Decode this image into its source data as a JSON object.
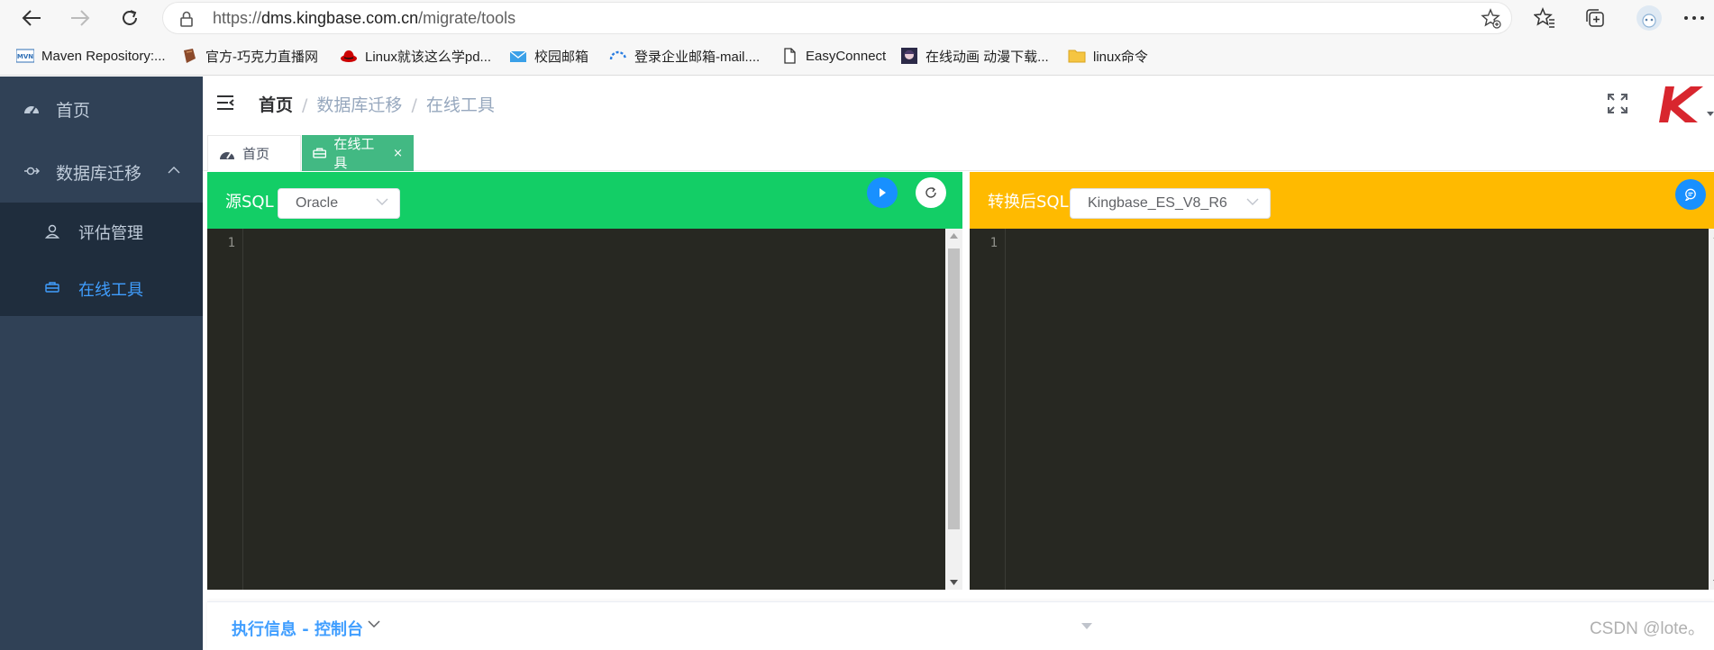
{
  "browser": {
    "url_prefix": "https://",
    "url_host": "dms.kingbase.com.cn",
    "url_path": "/migrate/tools"
  },
  "bookmarks": [
    {
      "label": "Maven Repository:...",
      "icon": "maven-icon"
    },
    {
      "label": "官方-巧克力直播网",
      "icon": "chocolate-icon"
    },
    {
      "label": "Linux就该这么学pd...",
      "icon": "redhat-icon"
    },
    {
      "label": "校园邮箱",
      "icon": "mail-icon"
    },
    {
      "label": "登录企业邮箱-mail....",
      "icon": "cloud-mail-icon"
    },
    {
      "label": "EasyConnect",
      "icon": "page-icon"
    },
    {
      "label": "在线动画 动漫下载...",
      "icon": "anime-icon"
    },
    {
      "label": "linux命令",
      "icon": "folder-icon"
    }
  ],
  "sidebar": {
    "home": "首页",
    "db_migrate": "数据库迁移",
    "items": [
      {
        "label": "评估管理"
      },
      {
        "label": "在线工具"
      }
    ]
  },
  "breadcrumb": {
    "home": "首页",
    "sep": "/",
    "level1": "数据库迁移",
    "level2": "在线工具"
  },
  "tags": {
    "home": "首页",
    "active": "在线工具",
    "close": "×"
  },
  "source": {
    "label": "源SQL",
    "db": "Oracle",
    "line": "1"
  },
  "target": {
    "label": "转换后SQL",
    "db": "Kingbase_ES_V8_R6",
    "line": "1"
  },
  "console": {
    "title": "执行信息 - 控制台"
  },
  "watermark": "CSDN @lote。",
  "colors": {
    "sidebar": "#304156",
    "submenu": "#1f2d3d",
    "active": "#409eff",
    "source_head": "#13ce66",
    "target_head": "#ffba00",
    "tag_active": "#42b983",
    "editor_bg": "#272822"
  }
}
